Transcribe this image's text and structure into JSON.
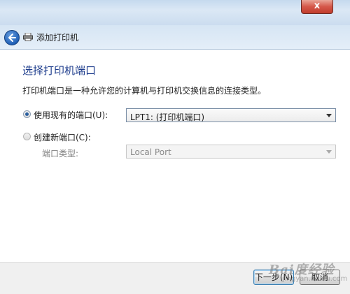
{
  "window": {
    "close_glyph": "x"
  },
  "nav": {
    "title": "添加打印机",
    "back_icon": "back-arrow-icon",
    "printer_icon": "printer-icon"
  },
  "page": {
    "heading": "选择打印机端口",
    "description": "打印机端口是一种允许您的计算机与打印机交换信息的连接类型。"
  },
  "options": {
    "use_existing": {
      "label": "使用现有的端口(U):",
      "selected": true,
      "dropdown_value": "LPT1: (打印机端口)"
    },
    "create_new": {
      "label": "创建新端口(C):",
      "selected": false,
      "port_type_label": "端口类型:",
      "dropdown_value": "Local Port"
    }
  },
  "buttons": {
    "next": "下一步(N)",
    "cancel": "取消"
  },
  "watermark": {
    "main": "Bai度经验",
    "sub": "jingyan.baidu.com"
  },
  "colors": {
    "heading": "#1d3c8c",
    "accent": "#3c7fb1"
  }
}
